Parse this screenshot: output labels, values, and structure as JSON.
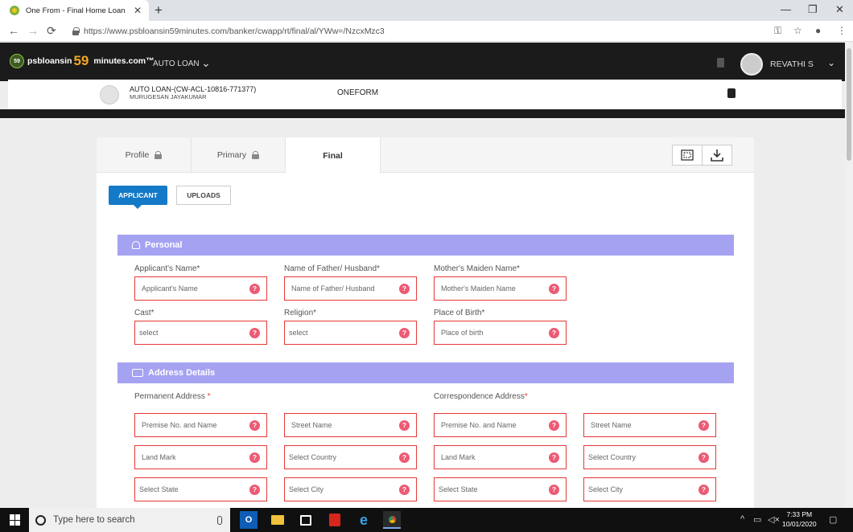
{
  "browser": {
    "tab_title": "One From - Final Home Loan",
    "tab_close": "✕",
    "new_tab": "+",
    "url": "https://www.psbloansin59minutes.com/banker/cwapp/rt/final/al/YWw=/NzcxMzc3",
    "minimize": "—",
    "restore": "❐",
    "close": "✕",
    "back": "←",
    "forward": "→",
    "reload": "⟳",
    "key_icon": "⚿",
    "star_icon": "☆",
    "profile_icon": "●",
    "menu_icon": "⋮"
  },
  "header": {
    "logo_badge": "59",
    "logo_prefix": "psbloansin",
    "logo_number": "59",
    "logo_suffix": "minutes.com™",
    "menu_label": "AUTO LOAN",
    "menu_chevron": "⌄",
    "user_name": "REVATHI S",
    "user_chevron": "⌄"
  },
  "loan": {
    "title": "AUTO LOAN-(CW-ACL-10816-771377)",
    "subtitle": "MURUGESAN JAYAKUMAR",
    "center": "ONEFORM"
  },
  "steps": {
    "profile": "Profile",
    "primary": "Primary",
    "final": "Final"
  },
  "subtabs": {
    "applicant": "APPLICANT",
    "uploads": "UPLOADS"
  },
  "personal": {
    "title": "Personal",
    "applicant_name_label": "Applicant's Name*",
    "applicant_name_ph": "Applicant's Name",
    "father_label": "Name of Father/ Husband*",
    "father_ph": "Name of Father/ Husband",
    "maiden_label": "Mother's Maiden Name*",
    "maiden_ph": "Mother's Maiden Name",
    "cast_label": "Cast*",
    "cast_value": "select",
    "religion_label": "Religion*",
    "religion_value": "select",
    "birth_label": "Place of Birth*",
    "birth_ph": "Place of birth"
  },
  "address": {
    "title": "Address Details",
    "permanent_label": "Permanent Address",
    "permanent_star": "*",
    "correspondence_label": "Correspondence Address",
    "correspondence_star": "*",
    "perm_premise": "Premise No. and Name",
    "perm_street": "Street Name",
    "perm_landmark": "Land Mark",
    "perm_country": "Select Country",
    "perm_state": "Select State",
    "perm_city": "Select City",
    "corr_premise": "Premise No. and Name",
    "corr_street": "Street Name",
    "corr_landmark": "Land Mark",
    "corr_country": "Select Country",
    "corr_state": "Select State",
    "corr_city": "Select City"
  },
  "help_glyph": "?",
  "taskbar": {
    "search_placeholder": "Type here to search",
    "time": "7:33 PM",
    "date": "10/01/2020",
    "tray_up": "^",
    "tray_network": "▭",
    "tray_volume": "◁×",
    "notification": "▢"
  }
}
